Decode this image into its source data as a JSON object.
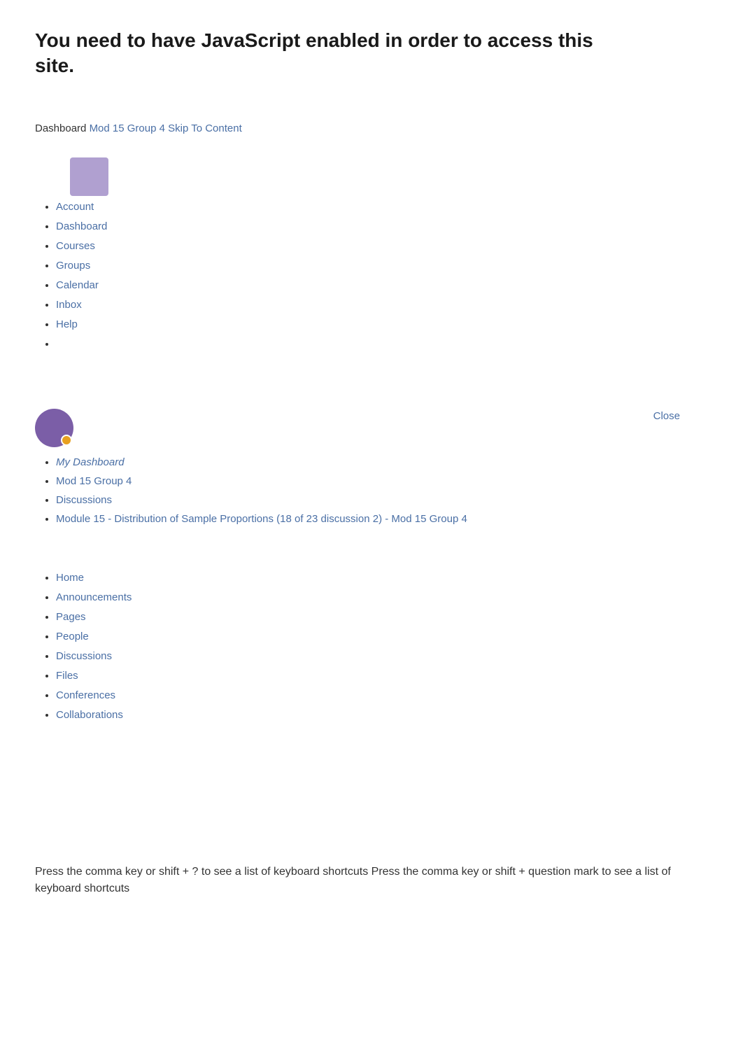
{
  "page": {
    "js_warning": "You need to have JavaScript enabled in order to access this site.",
    "footer_text": "Press the comma key or shift + ? to see a list of keyboard shortcuts Press the comma key or shift + question mark to see a list of keyboard shortcuts"
  },
  "breadcrumb": {
    "dashboard_label": "Dashboard",
    "group_label": "Mod 15 Group 4",
    "skip_label": "Skip To Content"
  },
  "top_nav": {
    "account_label": "Account",
    "items": [
      {
        "label": "Dashboard",
        "href": "#"
      },
      {
        "label": "Courses",
        "href": "#"
      },
      {
        "label": "Groups",
        "href": "#"
      },
      {
        "label": "Calendar",
        "href": "#"
      },
      {
        "label": "Inbox",
        "href": "#"
      },
      {
        "label": "Help",
        "href": "#"
      }
    ]
  },
  "close_button": {
    "label": "Close"
  },
  "breadcrumb_nav": {
    "items": [
      {
        "label": "My Dashboard",
        "href": "#",
        "italic": true
      },
      {
        "label": "Mod 15 Group 4",
        "href": "#",
        "italic": false
      },
      {
        "label": "Discussions",
        "href": "#",
        "italic": false
      },
      {
        "label": "Module 15 - Distribution of Sample Proportions (18 of 23 discussion 2) - Mod 15 Group 4",
        "href": "#",
        "italic": false
      }
    ]
  },
  "group_nav": {
    "items": [
      {
        "label": "Home",
        "href": "#"
      },
      {
        "label": "Announcements",
        "href": "#"
      },
      {
        "label": "Pages",
        "href": "#"
      },
      {
        "label": "People",
        "href": "#"
      },
      {
        "label": "Discussions",
        "href": "#"
      },
      {
        "label": "Files",
        "href": "#"
      },
      {
        "label": "Conferences",
        "href": "#"
      },
      {
        "label": "Collaborations",
        "href": "#"
      }
    ]
  }
}
